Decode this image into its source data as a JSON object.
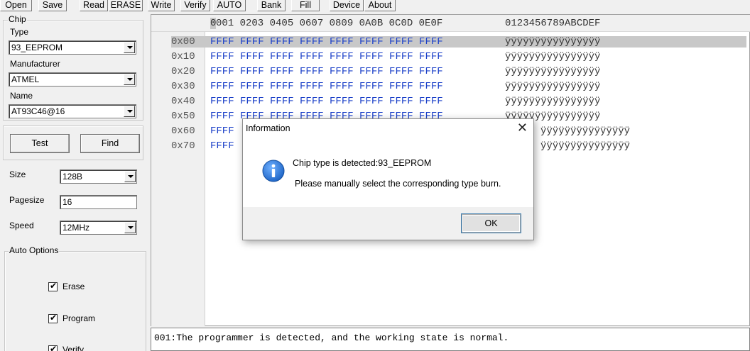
{
  "toolbar": {
    "buttons": [
      "Open",
      "Save",
      "Read",
      "ERASE",
      "Write",
      "Verify",
      "AUTO",
      "Bank",
      "Fill",
      "Device",
      "About"
    ]
  },
  "chip": {
    "legend": "Chip",
    "type_label": "Type",
    "type_value": "93_EEPROM",
    "manufacturer_label": "Manufacturer",
    "manufacturer_value": "ATMEL",
    "name_label": "Name",
    "name_value": "AT93C46@16",
    "test_button": "Test",
    "find_button": "Find"
  },
  "settings": {
    "size_label": "Size",
    "size_value": "128B",
    "pagesize_label": "Pagesize",
    "pagesize_value": "16",
    "speed_label": "Speed",
    "speed_value": "12MHz"
  },
  "auto_options": {
    "legend": "Auto Options",
    "erase_label": "Erase",
    "erase_checked": true,
    "program_label": "Program",
    "program_checked": true,
    "verify_label": "Verify",
    "verify_checked": true
  },
  "hex": {
    "header_prefix": "0",
    "header_cols": "001 0203 0405 0607 0809 0A0B 0C0D 0E0F",
    "header_ascii": "0123456789ABCDEF",
    "rows": [
      {
        "addr": "0x00",
        "data": "FFFF FFFF FFFF FFFF FFFF FFFF FFFF FFFF",
        "ascii": "ÿÿÿÿÿÿÿÿÿÿÿÿÿÿÿÿ"
      },
      {
        "addr": "0x10",
        "data": "FFFF FFFF FFFF FFFF FFFF FFFF FFFF FFFF",
        "ascii": "ÿÿÿÿÿÿÿÿÿÿÿÿÿÿÿÿ"
      },
      {
        "addr": "0x20",
        "data": "FFFF FFFF FFFF FFFF FFFF FFFF FFFF FFFF",
        "ascii": "ÿÿÿÿÿÿÿÿÿÿÿÿÿÿÿÿ"
      },
      {
        "addr": "0x30",
        "data": "FFFF FFFF FFFF FFFF FFFF FFFF FFFF FFFF",
        "ascii": "ÿÿÿÿÿÿÿÿÿÿÿÿÿÿÿÿ"
      },
      {
        "addr": "0x40",
        "data": "FFFF FFFF FFFF FFFF FFFF FFFF FFFF FFFF",
        "ascii": "ÿÿÿÿÿÿÿÿÿÿÿÿÿÿÿÿ"
      },
      {
        "addr": "0x50",
        "data": "FFFF FFFF FFFF FFFF FFFF FFFF FFFF FFFF",
        "ascii": "ÿÿÿÿÿÿÿÿÿÿÿÿÿÿÿÿ"
      },
      {
        "addr": "0x60",
        "data": "FFFF",
        "ascii": "ÿÿÿÿÿÿÿÿÿÿÿÿÿÿÿ"
      },
      {
        "addr": "0x70",
        "data": "FFFF",
        "ascii": "ÿÿÿÿÿÿÿÿÿÿÿÿÿÿÿ"
      }
    ]
  },
  "log": {
    "line": "001:The programmer is detected, and the working state is normal."
  },
  "dialog": {
    "title": "Information",
    "close_glyph": "✕",
    "message1": "Chip type is detected:93_EEPROM",
    "message2": "Please manually select the corresponding type burn.",
    "ok_label": "OK",
    "icon": "info-icon",
    "icon_color": "#1b62c4"
  }
}
